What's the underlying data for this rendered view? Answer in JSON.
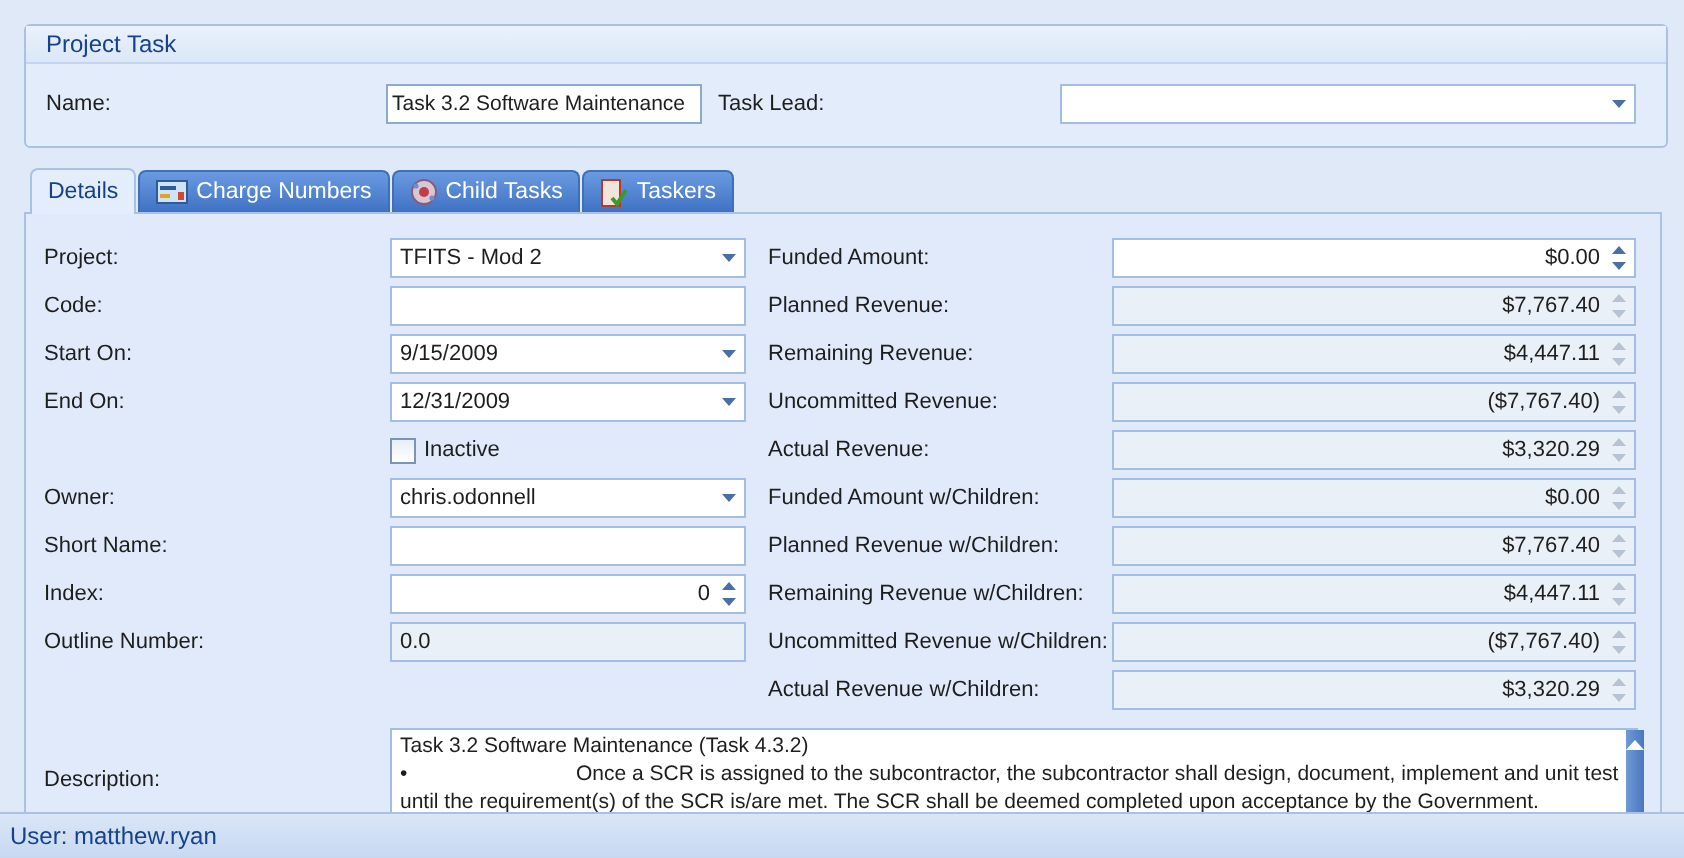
{
  "group": {
    "title": "Project Task",
    "name": {
      "label": "Name:",
      "value": "Task 3.2 Software Maintenance"
    },
    "task_lead": {
      "label": "Task Lead:"
    }
  },
  "tabs": [
    {
      "label": "Details",
      "selected": true
    },
    {
      "label": "Charge Numbers",
      "selected": false
    },
    {
      "label": "Child Tasks",
      "selected": false
    },
    {
      "label": "Taskers",
      "selected": false
    }
  ],
  "left_fields": [
    {
      "kind": "combo",
      "label": "Project:",
      "value": "TFITS - Mod 2"
    },
    {
      "kind": "text",
      "label": "Code:"
    },
    {
      "kind": "combo",
      "label": "Start On:",
      "value": "9/15/2009"
    },
    {
      "kind": "combo",
      "label": "End On:",
      "value": "12/31/2009"
    },
    {
      "kind": "checkbox",
      "label": "Inactive",
      "checked": false
    },
    {
      "kind": "combo",
      "label": "Owner:",
      "value": "chris.odonnell"
    },
    {
      "kind": "text",
      "label": "Short Name:"
    },
    {
      "kind": "spin",
      "label": "Index:",
      "value": "0"
    },
    {
      "kind": "readonly",
      "label": "Outline Number:",
      "value": "0.0"
    }
  ],
  "right_fields": [
    {
      "label": "Funded Amount:",
      "value": "$0.00",
      "disabled": false
    },
    {
      "label": "Planned Revenue:",
      "value": "$7,767.40",
      "disabled": true
    },
    {
      "label": "Remaining Revenue:",
      "value": "$4,447.11",
      "disabled": true
    },
    {
      "label": "Uncommitted Revenue:",
      "value": "($7,767.40)",
      "disabled": true
    },
    {
      "label": "Actual Revenue:",
      "value": "$3,320.29",
      "disabled": true
    },
    {
      "label": "Funded Amount w/Children:",
      "value": "$0.00",
      "disabled": true
    },
    {
      "label": "Planned Revenue w/Children:",
      "value": "$7,767.40",
      "disabled": true
    },
    {
      "label": "Remaining Revenue w/Children:",
      "value": "$4,447.11",
      "disabled": true
    },
    {
      "label": "Uncommitted Revenue w/Children:",
      "value": "($7,767.40)",
      "disabled": true
    },
    {
      "label": "Actual Revenue w/Children:",
      "value": "$3,320.29",
      "disabled": true
    }
  ],
  "description": {
    "label": "Description:",
    "heading": "Task 3.2  Software Maintenance (Task 4.3.2)",
    "bullet": "•",
    "lines": [
      "Once a SCR is assigned to the subcontractor, the subcontractor shall design, document, implement and unit test",
      "until the requirement(s) of the SCR is/are met. The SCR shall be deemed completed upon acceptance by the Government."
    ]
  },
  "status_bar": {
    "user": "User: matthew.ryan"
  }
}
